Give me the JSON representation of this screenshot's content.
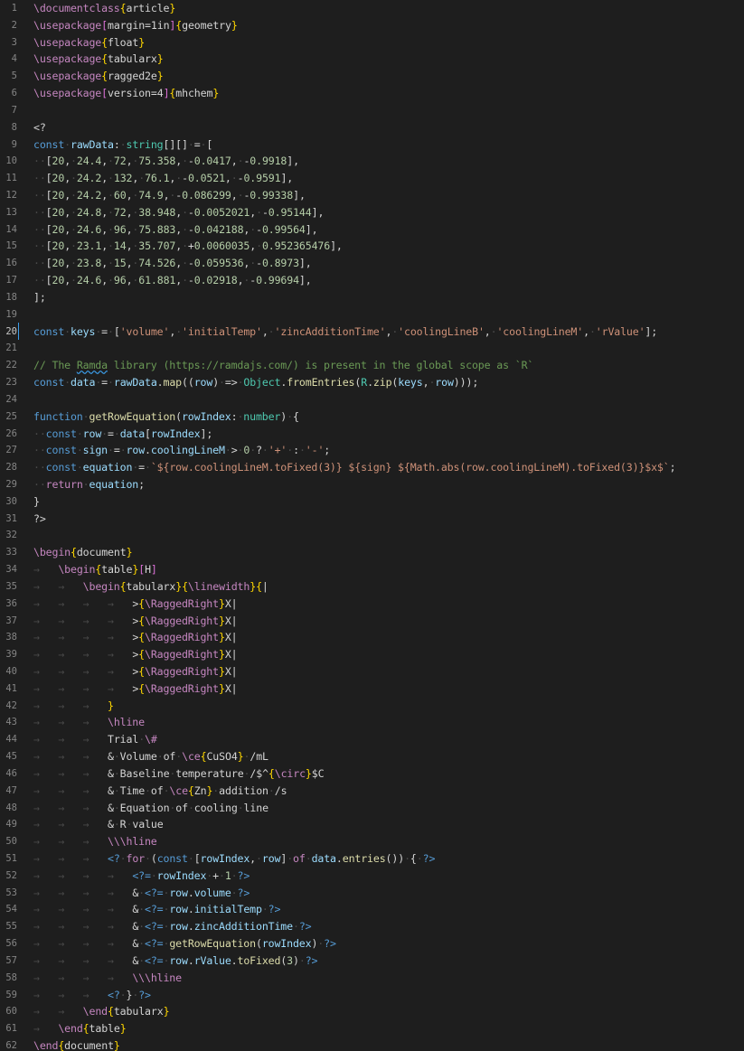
{
  "editor": {
    "language": "LaTeX with embedded TypeScript",
    "current_line": 20,
    "lines": [
      {
        "n": "1",
        "t": "\\documentclass{article}"
      },
      {
        "n": "2",
        "t": "\\usepackage[margin=1in]{geometry}"
      },
      {
        "n": "3",
        "t": "\\usepackage{float}"
      },
      {
        "n": "4",
        "t": "\\usepackage{tabularx}"
      },
      {
        "n": "5",
        "t": "\\usepackage{ragged2e}"
      },
      {
        "n": "6",
        "t": "\\usepackage[version=4]{mhchem}"
      },
      {
        "n": "7",
        "t": ""
      },
      {
        "n": "8",
        "t": "<?"
      },
      {
        "n": "9",
        "t": "const rawData: string[][] = ["
      },
      {
        "n": "10",
        "t": "  [20, 24.4, 72, 75.358, -0.0417, -0.9918],"
      },
      {
        "n": "11",
        "t": "  [20, 24.2, 132, 76.1, -0.0521, -0.9591],"
      },
      {
        "n": "12",
        "t": "  [20, 24.2, 60, 74.9, -0.086299, -0.99338],"
      },
      {
        "n": "13",
        "t": "  [20, 24.8, 72, 38.948, -0.0052021, -0.95144],"
      },
      {
        "n": "14",
        "t": "  [20, 24.6, 96, 75.883, -0.042188, -0.99564],"
      },
      {
        "n": "15",
        "t": "  [20, 23.1, 14, 35.707, +0.0060035, 0.952365476],"
      },
      {
        "n": "16",
        "t": "  [20, 23.8, 15, 74.526, -0.059536, -0.8973],"
      },
      {
        "n": "17",
        "t": "  [20, 24.6, 96, 61.881, -0.02918, -0.99694],"
      },
      {
        "n": "18",
        "t": "];"
      },
      {
        "n": "19",
        "t": ""
      },
      {
        "n": "20",
        "t": "const keys = ['volume', 'initialTemp', 'zincAdditionTime', 'coolingLineB', 'coolingLineM', 'rValue'];"
      },
      {
        "n": "21",
        "t": ""
      },
      {
        "n": "22",
        "t": "// The Ramda library (https://ramdajs.com/) is present in the global scope as `R`"
      },
      {
        "n": "23",
        "t": "const data = rawData.map((row) => Object.fromEntries(R.zip(keys, row)));"
      },
      {
        "n": "24",
        "t": ""
      },
      {
        "n": "25",
        "t": "function getRowEquation(rowIndex: number) {"
      },
      {
        "n": "26",
        "t": "  const row = data[rowIndex];"
      },
      {
        "n": "27",
        "t": "  const sign = row.coolingLineM > 0 ? '+' : '-';"
      },
      {
        "n": "28",
        "t": "  const equation = `${row.coolingLineM.toFixed(3)} ${sign} ${Math.abs(row.coolingLineM).toFixed(3)}$x$`;"
      },
      {
        "n": "29",
        "t": "  return equation;"
      },
      {
        "n": "30",
        "t": "}"
      },
      {
        "n": "31",
        "t": "?>"
      },
      {
        "n": "32",
        "t": ""
      },
      {
        "n": "33",
        "t": "\\begin{document}"
      },
      {
        "n": "34",
        "t": "\t\\begin{table}[H]"
      },
      {
        "n": "35",
        "t": "\t\t\\begin{tabularx}{\\linewidth}{|"
      },
      {
        "n": "36",
        "t": "\t\t\t\t>{\\RaggedRight}X|"
      },
      {
        "n": "37",
        "t": "\t\t\t\t>{\\RaggedRight}X|"
      },
      {
        "n": "38",
        "t": "\t\t\t\t>{\\RaggedRight}X|"
      },
      {
        "n": "39",
        "t": "\t\t\t\t>{\\RaggedRight}X|"
      },
      {
        "n": "40",
        "t": "\t\t\t\t>{\\RaggedRight}X|"
      },
      {
        "n": "41",
        "t": "\t\t\t\t>{\\RaggedRight}X|"
      },
      {
        "n": "42",
        "t": "\t\t\t}"
      },
      {
        "n": "43",
        "t": "\t\t\t\\hline"
      },
      {
        "n": "44",
        "t": "\t\t\tTrial \\#"
      },
      {
        "n": "45",
        "t": "\t\t\t& Volume of \\ce{CuSO4} /mL"
      },
      {
        "n": "46",
        "t": "\t\t\t& Baseline temperature /$^{\\circ}$C"
      },
      {
        "n": "47",
        "t": "\t\t\t& Time of \\ce{Zn} addition /s"
      },
      {
        "n": "48",
        "t": "\t\t\t& Equation of cooling line"
      },
      {
        "n": "49",
        "t": "\t\t\t& R value"
      },
      {
        "n": "50",
        "t": "\t\t\t\\\\\\hline"
      },
      {
        "n": "51",
        "t": "\t\t\t<? for (const [rowIndex, row] of data.entries()) { ?>"
      },
      {
        "n": "52",
        "t": "\t\t\t\t<?= rowIndex + 1 ?>"
      },
      {
        "n": "53",
        "t": "\t\t\t\t& <?= row.volume ?>"
      },
      {
        "n": "54",
        "t": "\t\t\t\t& <?= row.initialTemp ?>"
      },
      {
        "n": "55",
        "t": "\t\t\t\t& <?= row.zincAdditionTime ?>"
      },
      {
        "n": "56",
        "t": "\t\t\t\t& <?= getRowEquation(rowIndex) ?>"
      },
      {
        "n": "57",
        "t": "\t\t\t\t& <?= row.rValue.toFixed(3) ?>"
      },
      {
        "n": "58",
        "t": "\t\t\t\t\\\\\\hline"
      },
      {
        "n": "59",
        "t": "\t\t\t<? } ?>"
      },
      {
        "n": "60",
        "t": "\t\t\\end{tabularx}"
      },
      {
        "n": "61",
        "t": "\t\\end{table}"
      },
      {
        "n": "62",
        "t": "\\end{document}"
      }
    ]
  }
}
